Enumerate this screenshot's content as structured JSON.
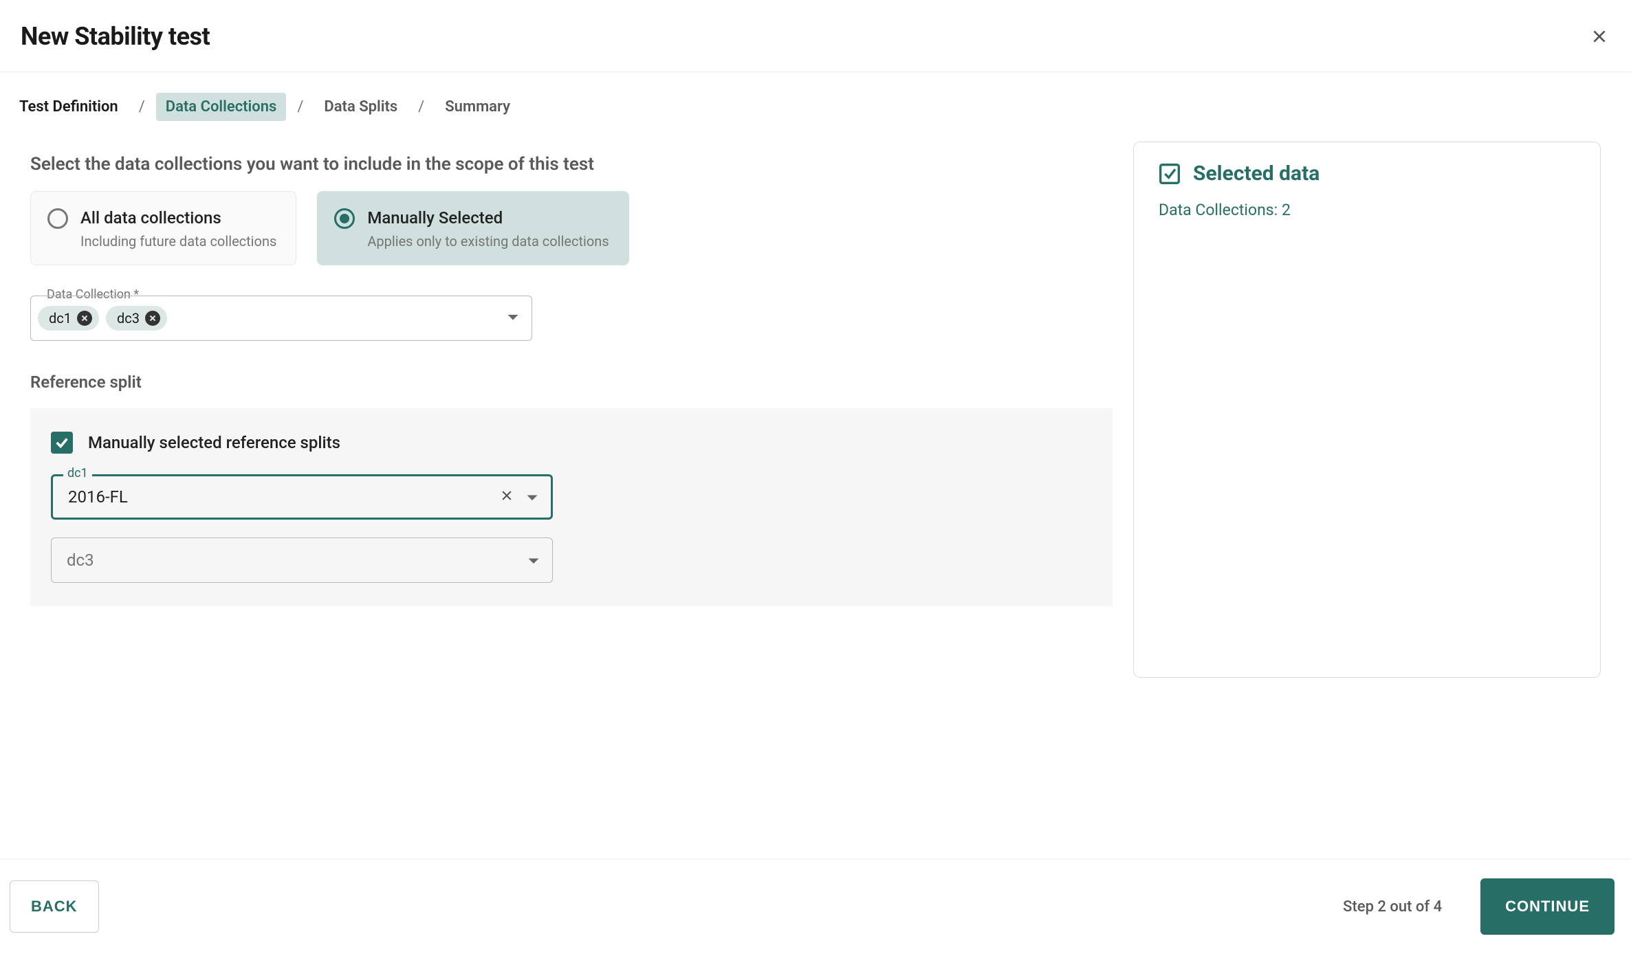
{
  "header": {
    "title": "New Stability test"
  },
  "breadcrumbs": [
    {
      "label": "Test Definition",
      "state": "done"
    },
    {
      "label": "Data Collections",
      "state": "active"
    },
    {
      "label": "Data Splits",
      "state": "pending"
    },
    {
      "label": "Summary",
      "state": "pending"
    }
  ],
  "section": {
    "heading": "Select the data collections you want to include in the scope of this test",
    "options": {
      "all": {
        "title": "All data collections",
        "subtitle": "Including future data collections",
        "selected": false
      },
      "manual": {
        "title": "Manually Selected",
        "subtitle": "Applies only to existing data collections",
        "selected": true
      }
    },
    "dataCollectionField": {
      "label": "Data Collection *",
      "chips": [
        "dc1",
        "dc3"
      ]
    }
  },
  "referenceSplit": {
    "heading": "Reference split",
    "checkboxLabel": "Manually selected reference splits",
    "checked": true,
    "fields": {
      "dc1": {
        "label": "dc1",
        "value": "2016-FL",
        "focused": true
      },
      "dc3": {
        "placeholder": "dc3",
        "value": ""
      }
    }
  },
  "sidePanel": {
    "title": "Selected data",
    "line1_label": "Data Collections: ",
    "line1_value": "2"
  },
  "footer": {
    "back": "BACK",
    "step": "Step 2 out of 4",
    "continue": "CONTINUE"
  }
}
